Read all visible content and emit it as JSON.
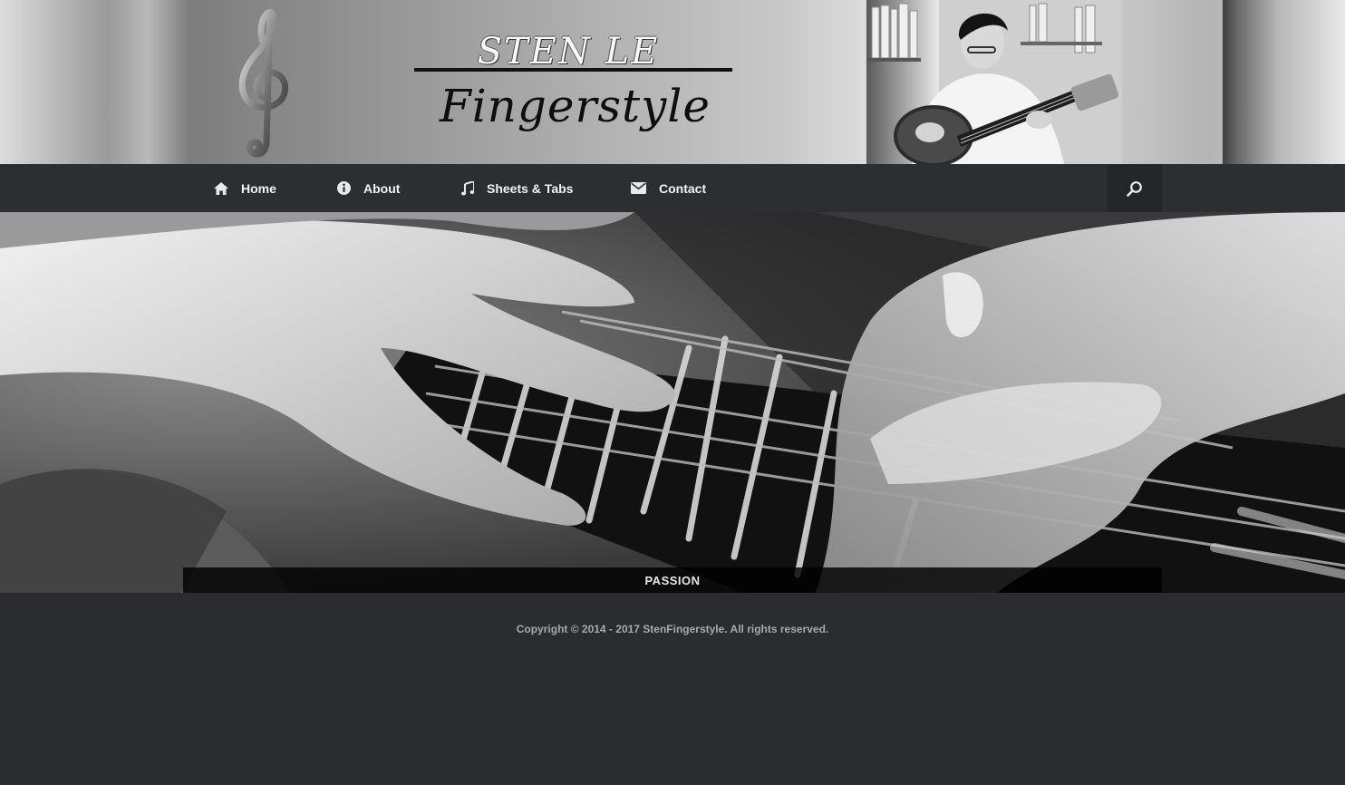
{
  "header": {
    "brand_name": "STEN LE",
    "brand_script": "Fingerstyle"
  },
  "nav": {
    "items": [
      {
        "label": "Home",
        "icon": "home-icon"
      },
      {
        "label": "About",
        "icon": "info-icon"
      },
      {
        "label": "Sheets & Tabs",
        "icon": "music-note-icon"
      },
      {
        "label": "Contact",
        "icon": "envelope-icon"
      }
    ],
    "search_icon": "search-icon"
  },
  "hero": {
    "caption": "PASSION"
  },
  "footer": {
    "copyright": "Copyright © 2014 - 2017 StenFingerstyle. All rights reserved."
  },
  "colors": {
    "nav_bg": "#2d2e32",
    "page_bg": "#2b2c30",
    "nav_text": "#f3f3f3",
    "footer_text": "#a9a9a9"
  }
}
